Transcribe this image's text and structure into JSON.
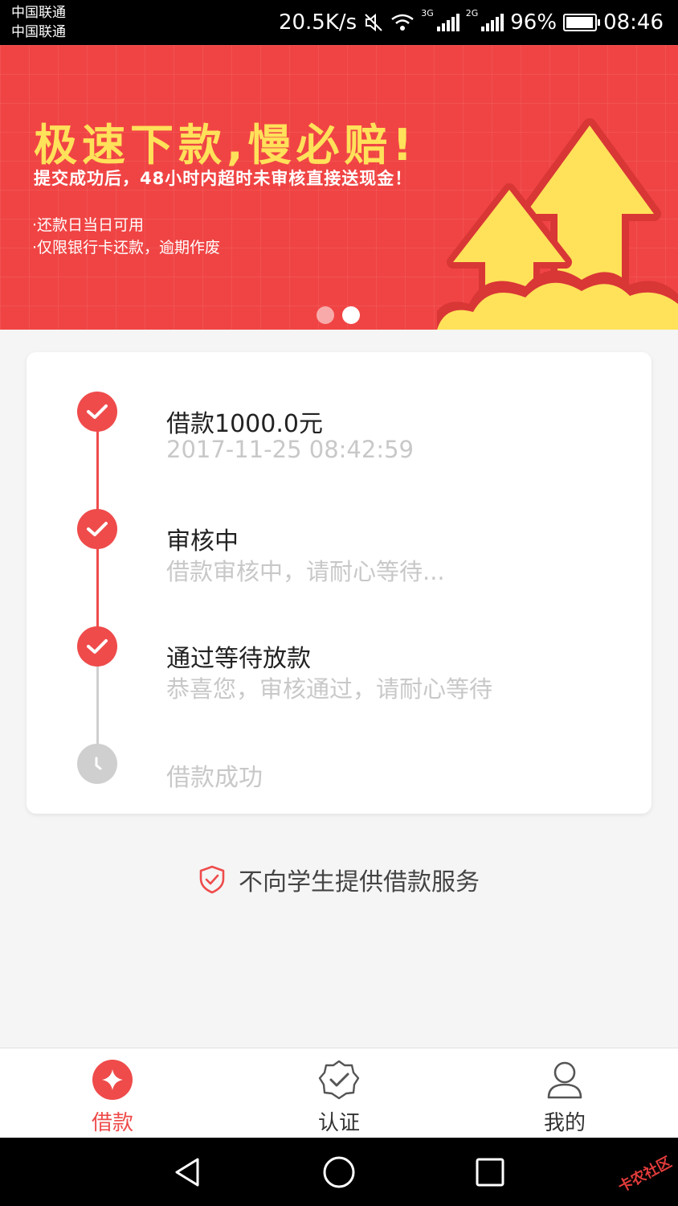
{
  "status_bar": {
    "carrier_1": "中国联通",
    "carrier_2": "中国联通",
    "speed": "20.5K/s",
    "net_1": "3G",
    "net_2": "2G",
    "battery_percent": "96%",
    "battery_level": 0.96,
    "time": "08:46"
  },
  "banner": {
    "headline": "极速下款,慢必赔!",
    "subtitle": "提交成功后，48小时内超时未审核直接送现金！",
    "bullets": [
      "·还款日当日可用",
      "·仅限银行卡还款，逾期作废"
    ],
    "slide_count": 2,
    "active_slide": 2
  },
  "progress": {
    "steps": [
      {
        "title": "借款1000.0元",
        "desc": "2017-11-25 08:42:59",
        "status": "done"
      },
      {
        "title": "审核中",
        "desc": "借款审核中，请耐心等待...",
        "status": "done"
      },
      {
        "title": "通过等待放款",
        "desc": "恭喜您，审核通过，请耐心等待",
        "status": "done"
      },
      {
        "title": "借款成功",
        "desc": "",
        "status": "pending"
      }
    ]
  },
  "notice": {
    "text": "不向学生提供借款服务",
    "icon": "shield-check-icon"
  },
  "tab_bar": {
    "tabs": [
      {
        "label": "借款",
        "icon": "loan-icon",
        "active": true
      },
      {
        "label": "认证",
        "icon": "verify-badge-icon",
        "active": false
      },
      {
        "label": "我的",
        "icon": "user-icon",
        "active": false
      }
    ]
  },
  "watermark": "卡农社区",
  "colors": {
    "accent": "#ef4b4b",
    "banner_bg": "#f04444",
    "headline": "#ffe15a",
    "muted": "#c8c8c8"
  }
}
